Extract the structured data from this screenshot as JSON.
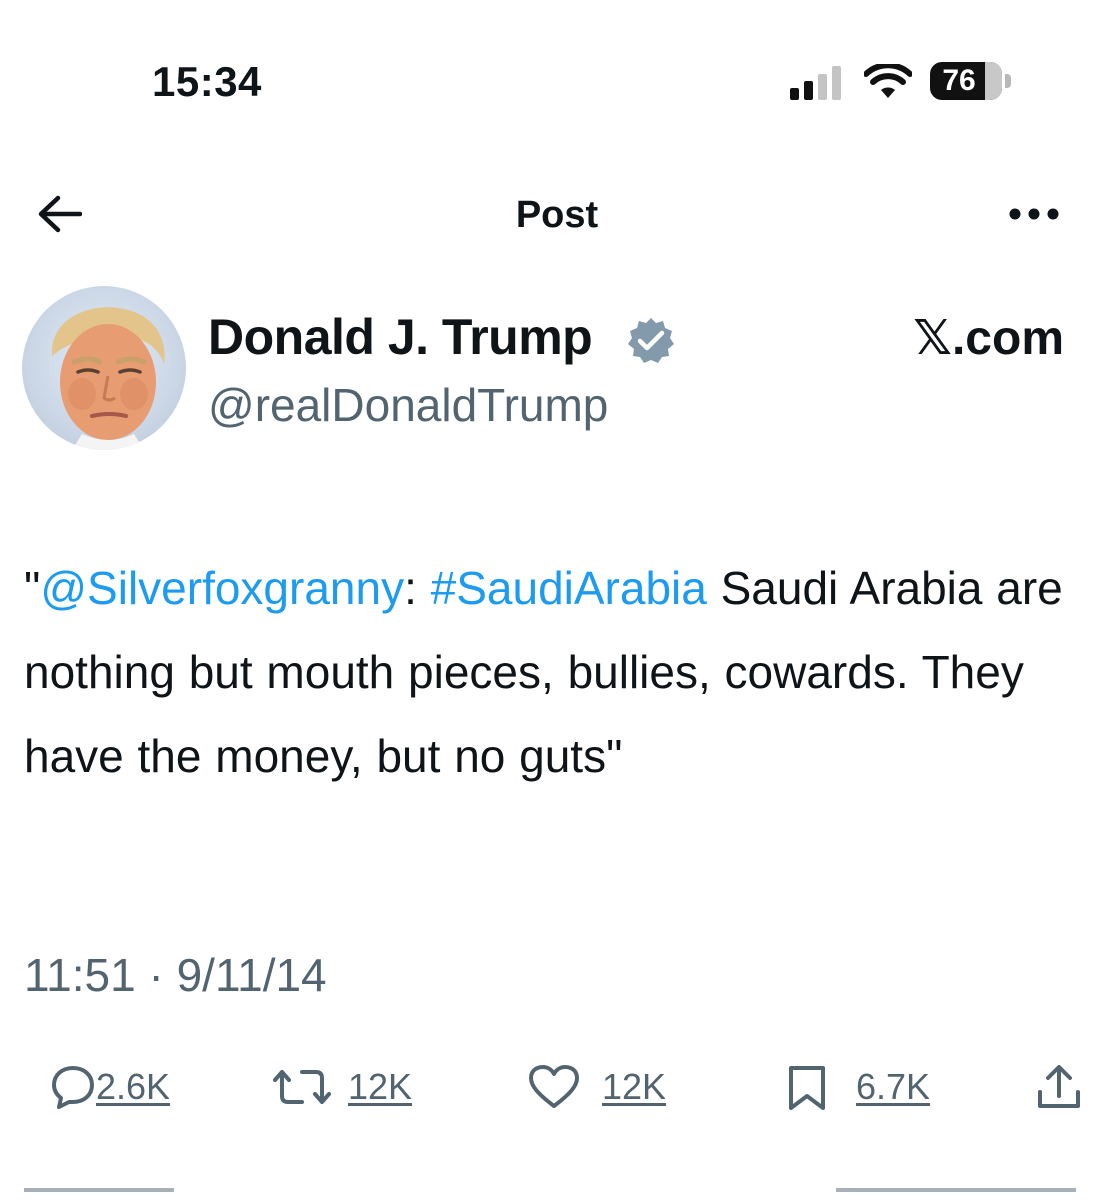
{
  "status_bar": {
    "time": "15:34",
    "battery_level": "76",
    "battery_fraction": 0.76
  },
  "header": {
    "title": "Post"
  },
  "author": {
    "display_name": "Donald J. Trump",
    "handle": "@realDonaldTrump",
    "verified": true,
    "source": "𝕏.com"
  },
  "tweet": {
    "quote_open": "\"",
    "mention": "@Silverfoxgranny",
    "colon": ":  ",
    "hashtag": "#SaudiArabia",
    "body": " Saudi Arabia are nothing but mouth pieces, bullies, cowards. They have the money, but no guts\"",
    "timestamp": "11:51 · 9/11/14"
  },
  "actions": {
    "replies": "2.6K",
    "reposts": "12K",
    "likes": "12K",
    "bookmarks": "6.7K"
  },
  "icons": {
    "back": "back-arrow-icon",
    "more": "more-options-icon",
    "verified": "verified-badge-icon",
    "reply": "reply-icon",
    "repost": "repost-icon",
    "like": "heart-icon",
    "bookmark": "bookmark-icon",
    "share": "share-icon"
  },
  "colors": {
    "link": "#1d9bf0",
    "muted": "#536471",
    "text": "#0f1419",
    "verified_badge": "#829aab"
  }
}
